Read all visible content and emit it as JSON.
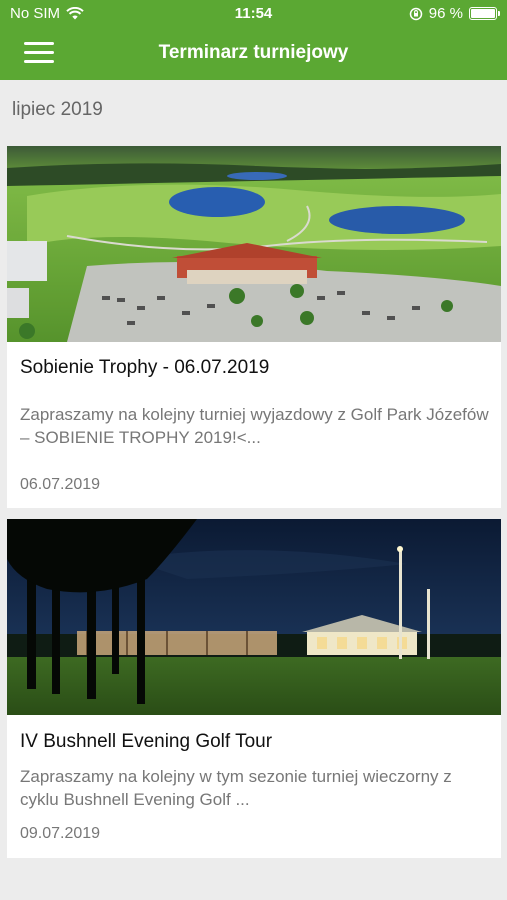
{
  "status_bar": {
    "carrier": "No SIM",
    "time": "11:54",
    "battery": "96 %",
    "battery_level": 0.96,
    "icons": [
      "wifi-icon",
      "orientation-lock-icon",
      "battery-icon"
    ]
  },
  "nav": {
    "title": "Terminarz turniejowy",
    "menu_icon": "hamburger-menu-icon"
  },
  "section": {
    "month": "lipiec 2019"
  },
  "events": [
    {
      "title": "Sobienie Trophy - 06.07.2019",
      "description": "Zapraszamy na kolejny turniej wyjazdowy z Golf Park Józefów – SOBIENIE TROPHY 2019!<...",
      "date": "06.07.2019"
    },
    {
      "title": "IV Bushnell Evening Golf Tour",
      "description": "Zapraszamy na kolejny w tym sezonie turniej wieczorny z cyklu Bushnell Evening Golf ...",
      "date": "09.07.2019"
    }
  ],
  "colors": {
    "accent": "#5ba833",
    "background": "#ececec",
    "card": "#ffffff"
  }
}
